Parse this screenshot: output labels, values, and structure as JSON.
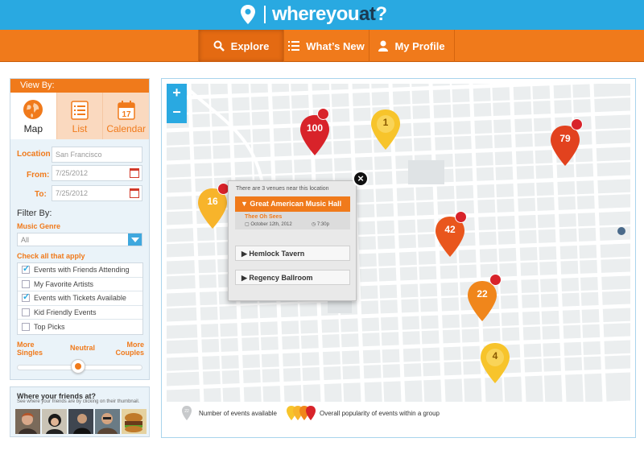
{
  "brand": {
    "name_part1": "where",
    "name_part2": "you",
    "name_part3": "at",
    "name_part4": "?"
  },
  "nav": [
    {
      "label": "Explore",
      "icon": "search-icon",
      "active": true
    },
    {
      "label": "What’s New",
      "icon": "list-icon",
      "active": false
    },
    {
      "label": "My Profile",
      "icon": "person-icon",
      "active": false
    }
  ],
  "sidebar": {
    "view_by": "View By:",
    "tabs": [
      {
        "label": "Map",
        "icon": "globe-icon"
      },
      {
        "label": "List",
        "icon": "list-icon"
      },
      {
        "label": "Calendar",
        "icon": "calendar-icon",
        "calendar_day": "17"
      }
    ],
    "location_label": "Location",
    "location_value": "San Francisco",
    "from_label": "From:",
    "from_value": "7/25/2012",
    "to_label": "To:",
    "to_value": "7/25/2012",
    "filter_by": "Filter By:",
    "genre_label": "Music Genre",
    "genre_value": "All",
    "check_label": "Check all that apply",
    "checks": [
      {
        "label": "Events with Friends Attending",
        "checked": true
      },
      {
        "label": "My Favorite Artists",
        "checked": false
      },
      {
        "label": "Events with Tickets Available",
        "checked": true
      },
      {
        "label": "Kid Friendly Events",
        "checked": false
      },
      {
        "label": "Top Picks",
        "checked": false
      }
    ],
    "slider_left": "More Singles",
    "slider_mid": "Neutral",
    "slider_right": "More Couples",
    "slider_value": 0.5
  },
  "friends": {
    "title": "Where your friends at?",
    "subtitle": "See where your friends are by clicking on their thumbnail."
  },
  "map": {
    "zoom_in": "+",
    "zoom_out": "−",
    "markers": [
      {
        "count": "100",
        "color": "#d8232a",
        "friend_badge": true
      },
      {
        "count": "1",
        "color": "#f7c42b",
        "friend_badge": false
      },
      {
        "count": "79",
        "color": "#e2421e",
        "friend_badge": true
      },
      {
        "count": "16",
        "color": "#f7b42b",
        "friend_badge": true
      },
      {
        "count": "42",
        "color": "#e9561d",
        "friend_badge": true
      },
      {
        "count": "22",
        "color": "#f0861b",
        "friend_badge": true
      },
      {
        "count": "4",
        "color": "#f7c42b",
        "friend_badge": false
      }
    ],
    "popup": {
      "intro": "There are 3 venues near this location",
      "active_venue": "Great American Music Hall",
      "band": "Thee Oh Sees",
      "date": "October 12th, 2012",
      "time": "7:30p",
      "venues": [
        "Hemlock Tavern",
        "Regency Ballroom"
      ],
      "close": "×"
    },
    "legend": {
      "count_example": "22",
      "count_text": "Number of events available",
      "popularity_text": "Overall popularity of events within a group"
    }
  },
  "colors": {
    "blue": "#29a9e1",
    "orange": "#f07a1b",
    "red": "#d8232a",
    "yellow": "#f7c42b"
  }
}
